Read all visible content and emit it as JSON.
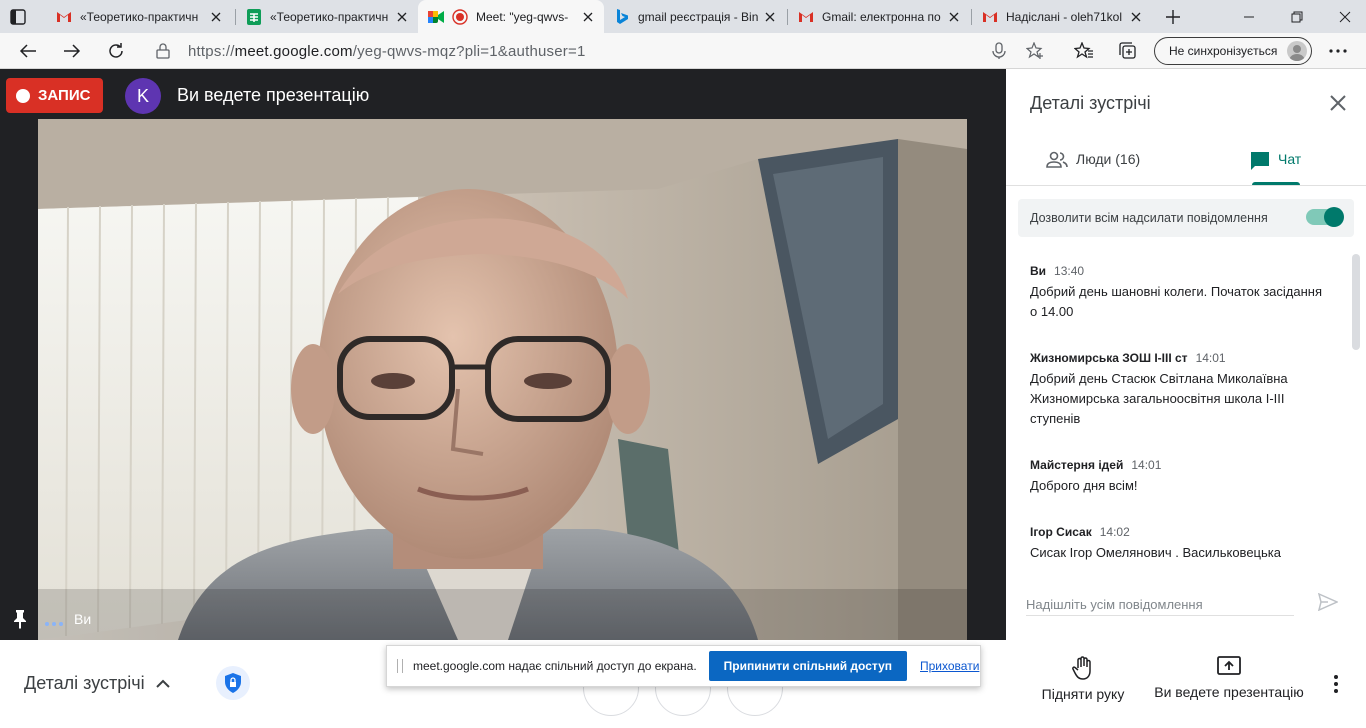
{
  "browser": {
    "tabs": [
      {
        "title": "«Теоретико-практичн",
        "icon": "gmail-icon",
        "active": false
      },
      {
        "title": "«Теоретико-практичн",
        "icon": "sheets-icon",
        "active": false
      },
      {
        "title": "Meet: \"yeg-qwvs-",
        "icon": "meet-icon",
        "active": true
      },
      {
        "title": "gmail реєстрація - Bin",
        "icon": "bing-icon",
        "active": false
      },
      {
        "title": "Gmail: електронна по",
        "icon": "gmail-icon",
        "active": false
      },
      {
        "title": "Надіслані - oleh71kol",
        "icon": "gmail-icon",
        "active": false
      }
    ],
    "url_prefix": "https://",
    "url_host": "meet.google.com",
    "url_path": "/yeg-qwvs-mqz?pli=1&authuser=1",
    "sync_label": "Не синхронізується"
  },
  "stage": {
    "recording_label": "ЗАПИС",
    "avatar_letter": "K",
    "presenting_title": "Ви ведете презентацію",
    "self_name": "Ви"
  },
  "panel": {
    "title": "Деталі зустрічі",
    "tab_people": "Люди (16)",
    "tab_chat": "Чат",
    "allow_messages": "Дозволити всім надсилати повідомлення",
    "allow_messages_enabled": true,
    "messages": [
      {
        "sender": "Ви",
        "time": "13:40",
        "text": "Добрий день шановні колеги. Початок засідання о 14.00"
      },
      {
        "sender": "Жизномирська ЗОШ І-ІІІ ст",
        "time": "14:01",
        "text": "Добрий день Стасюк Світлана Миколаївна Жизномирська загальноосвітня школа І-ІІІ ступенів"
      },
      {
        "sender": "Майстерня ідей",
        "time": "14:01",
        "text": "Доброго дня всім!"
      },
      {
        "sender": "Ігор Сисак",
        "time": "14:02",
        "text": "Сисак Ігор Омелянович . Васильковецька"
      }
    ],
    "compose_placeholder": "Надішліть усім повідомлення"
  },
  "bottom": {
    "meeting_details": "Деталі зустрічі",
    "raise_hand": "Підняти руку",
    "presenting": "Ви ведете презентацію"
  },
  "share_notice": {
    "text": "meet.google.com надає спільний доступ до екрана.",
    "stop_label": "Припинити спільний доступ",
    "hide_label": "Приховати"
  },
  "colors": {
    "record_red": "#d93025",
    "meet_teal": "#00796b",
    "stop_blue": "#0b67c2",
    "avatar_purple": "#5e35b1"
  }
}
